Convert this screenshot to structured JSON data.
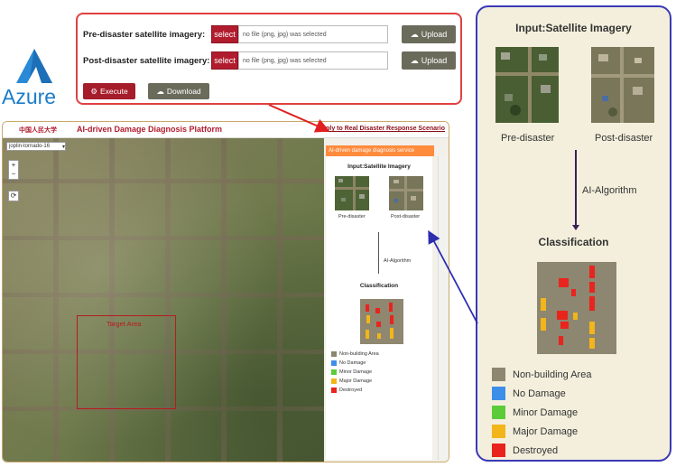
{
  "azure": {
    "wordmark": "Azure"
  },
  "upload_panel": {
    "pre": {
      "label": "Pre-disaster satellite imagery:",
      "select_label": "select",
      "file_placeholder": "no file (png,  jpg) was selected",
      "upload_label": "Upload"
    },
    "post": {
      "label": "Post-disaster satellite imagery:",
      "select_label": "select",
      "file_placeholder": "no file (png,  jpg) was selected",
      "upload_label": "Upload"
    },
    "execute_label": "Execute",
    "download_label": "Download"
  },
  "platform": {
    "logo_text": "中国人民大学",
    "title": "AI-driven Damage Diagnosis Platform",
    "apply_link": "Apply to Real Disaster Response Scenario",
    "region_select": "joplin-tornado-16",
    "target_label": "Target Area",
    "side_tab": "AI-driven damage diagnosis service",
    "mini": {
      "input_title": "Input:Satellite Imagery",
      "pre_caption": "Pre-disaster",
      "post_caption": "Post-disaster",
      "algo_label": "AI-Algorithm",
      "class_title": "Classification",
      "legend": [
        "Non-building Area",
        "No Damage",
        "Minor Damage",
        "Major Damage",
        "Destroyed"
      ]
    }
  },
  "flowchart": {
    "input_title": "Input:Satellite Imagery",
    "pre_caption": "Pre-disaster",
    "post_caption": "Post-disaster",
    "algo_label": "AI-Algorithm",
    "class_title": "Classification",
    "legend": [
      {
        "label": "Non-building Area",
        "color": "#8d8670"
      },
      {
        "label": "No Damage",
        "color": "#3d8ee8"
      },
      {
        "label": "Minor Damage",
        "color": "#5ccb3a"
      },
      {
        "label": "Major Damage",
        "color": "#f2b51a"
      },
      {
        "label": "Destroyed",
        "color": "#e8241c"
      }
    ]
  },
  "colors": {
    "panel_border": "#e04040",
    "flow_border": "#3a3ab8",
    "execute": "#a51c2a",
    "select": "#b01c2e",
    "side_tab": "#ff8b3d"
  }
}
